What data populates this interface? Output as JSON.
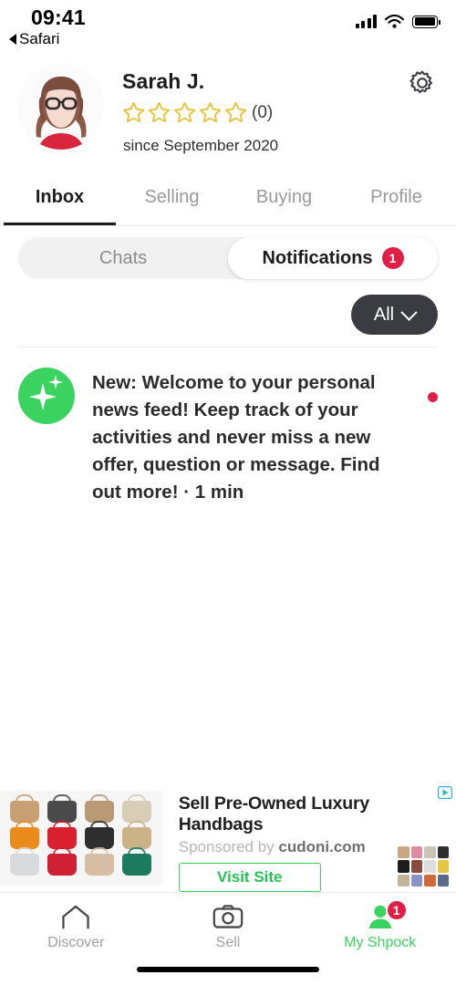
{
  "status_bar": {
    "time": "09:41",
    "back_label": "Safari",
    "icons": [
      "signal-bars-icon",
      "wifi-icon",
      "battery-icon"
    ]
  },
  "profile": {
    "name": "Sarah J.",
    "rating_value": 0,
    "rating_max": 5,
    "rating_count_label": "(0)",
    "member_since": "since September 2020",
    "avatar_alt": "avatar",
    "settings_icon": "gear-icon"
  },
  "main_tabs": [
    {
      "label": "Inbox",
      "active": true
    },
    {
      "label": "Selling",
      "active": false
    },
    {
      "label": "Buying",
      "active": false
    },
    {
      "label": "Profile",
      "active": false
    }
  ],
  "segmented": [
    {
      "label": "Chats",
      "active": false,
      "badge": ""
    },
    {
      "label": "Notifications",
      "active": true,
      "badge": "1"
    }
  ],
  "filter": {
    "label": "All",
    "icon": "chevron-down-icon"
  },
  "notifications": [
    {
      "icon": "sparkle-icon",
      "text": "New: Welcome to your personal news feed! Keep track of your activities and never miss a new offer, question or message. Find out more! · 1 min",
      "unread": true
    }
  ],
  "ad": {
    "title": "Sell Pre-Owned Luxury Handbags",
    "sponsored_prefix": "Sponsored by ",
    "sponsor": "cudoni.com",
    "cta_label": "Visit Site",
    "adchoices_icon": "adchoices-icon",
    "image_alt": "handbag-collage",
    "bag_colors": [
      "#c8a074",
      "#4a4a4a",
      "#b99a74",
      "#d8cdb6",
      "#eb8b1c",
      "#d8202f",
      "#2e2e2e",
      "#cbb287",
      "#d9dadb",
      "#cf1f33",
      "#d6bda4",
      "#1c7a5e"
    ],
    "thumb_colors": [
      "#c7a882",
      "#e08ba0",
      "#c9c4b4",
      "#2e2e2e",
      "#1c1c1c",
      "#8a4a3c",
      "#dddddd",
      "#e4c642",
      "#c2b49a",
      "#8a93c8",
      "#d2673a",
      "#5a6a8a"
    ]
  },
  "bottom_nav": [
    {
      "label": "Discover",
      "icon": "home-icon",
      "active": false,
      "badge": ""
    },
    {
      "label": "Sell",
      "icon": "camera-icon",
      "active": false,
      "badge": ""
    },
    {
      "label": "My Shpock",
      "icon": "person-icon",
      "active": true,
      "badge": "1"
    }
  ],
  "colors": {
    "accent_green": "#3ad35f",
    "badge_red": "#e01e47",
    "star_gold": "#e8c33c",
    "dark_pill": "#3b3b42"
  }
}
